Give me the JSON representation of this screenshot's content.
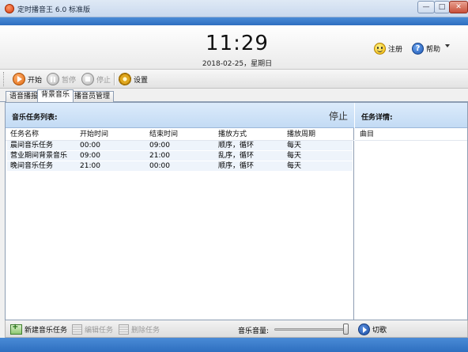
{
  "window": {
    "title": "定时播音王 6.0 标准版",
    "minimize": "—",
    "maximize": "□",
    "close": "✕"
  },
  "clock": {
    "time": "11:29",
    "date": "2018-02-25，星期日"
  },
  "top_links": {
    "register": "注册",
    "help": "帮助"
  },
  "toolbar": {
    "start": "开始",
    "pause": "暂停",
    "stop": "停止",
    "settings": "设置"
  },
  "tabs": [
    "语音播报",
    "背景音乐",
    "播音员管理"
  ],
  "music_panel": {
    "title": "音乐任务列表:",
    "state": "停止",
    "columns": [
      "任务名称",
      "开始时间",
      "结束时间",
      "播放方式",
      "播放周期"
    ],
    "rows": [
      [
        "晨间音乐任务",
        "00:00",
        "09:00",
        "顺序，循环",
        "每天"
      ],
      [
        "营业期间背景音乐",
        "09:00",
        "21:00",
        "乱序，循环",
        "每天"
      ],
      [
        "晚间音乐任务",
        "21:00",
        "00:00",
        "顺序，循环",
        "每天"
      ]
    ]
  },
  "detail_panel": {
    "title": "任务详情:",
    "column": "曲目"
  },
  "bottom": {
    "new_task": "新建音乐任务",
    "edit_task": "编辑任务",
    "delete_task": "删除任务",
    "volume_label": "音乐音量:",
    "volume_level": 1.0,
    "switch_song": "切歌"
  },
  "colors": {
    "accent_blue": "#2e6fc0",
    "panel_header": "#c3dbf4",
    "start_orange": "#e06a10"
  }
}
